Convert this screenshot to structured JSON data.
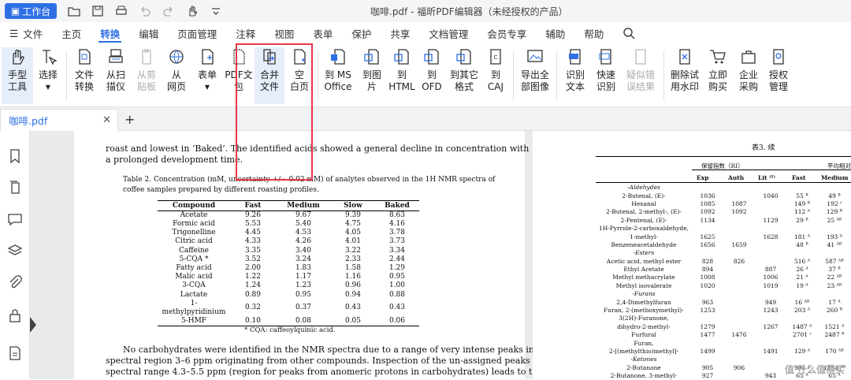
{
  "titlebar": {
    "work_label": "工作台",
    "title": "咖啡.pdf - 福昕PDF编辑器（未经授权的产品）"
  },
  "menu": [
    "文件",
    "主页",
    "转换",
    "编辑",
    "页面管理",
    "注释",
    "视图",
    "表单",
    "保护",
    "共享",
    "文档管理",
    "会员专享",
    "辅助",
    "帮助"
  ],
  "ribbon": {
    "hand": "手型\n工具",
    "select": "选择",
    "file_convert": "文件\n转换",
    "scan": "从扫\n描仪",
    "clipboard": "从剪\n贴板",
    "web": "从\n网页",
    "form": "表单",
    "pdf_pack": "PDF文\n包",
    "merge": "合并\n文件",
    "blank": "空\n白页",
    "to_ms": "到 MS\nOffice",
    "to_img": "到图\n片",
    "to_html": "到\nHTML",
    "to_ofd": "到\nOFD",
    "to_other": "到其它\n格式",
    "to_caj": "到\nCAJ",
    "export_img": "导出全\n部图像",
    "ocr": "识别\n文本",
    "quick_ocr": "快速\n识别",
    "suspect": "疑似错\n误结果",
    "remove_wm": "删除试\n用水印",
    "buy": "立即\n购买",
    "enterprise": "企业\n采购",
    "license": "授权\n管理"
  },
  "tabs": {
    "doc": "咖啡.pdf",
    "add": "+"
  },
  "page1": {
    "para1a": "roast and lowest in ‘Baked’. The identified acids showed a general decline in concentration with",
    "para1b": "a prolonged development time.",
    "caption_a": "Table 2. Concentration (mM, uncertainty +/− 0.02 mM) of analytes observed in the 1H NMR spectra of",
    "caption_b": "coffee samples prepared by different roasting profiles.",
    "headers": [
      "Compound",
      "Fast",
      "Medium",
      "Slow",
      "Baked"
    ],
    "rows": [
      [
        "Acetate",
        "9.26",
        "9.67",
        "9.39",
        "8.63"
      ],
      [
        "Formic acid",
        "5.53",
        "5.40",
        "4.75",
        "4.16"
      ],
      [
        "Trigonelline",
        "4.45",
        "4.53",
        "4.05",
        "3.78"
      ],
      [
        "Citric acid",
        "4.33",
        "4.26",
        "4.01",
        "3.73"
      ],
      [
        "Caffeine",
        "3.35",
        "3.40",
        "3.22",
        "3.34"
      ],
      [
        "5-CQA *",
        "3.52",
        "3.24",
        "2.33",
        "2.44"
      ],
      [
        "Fatty acid",
        "2.00",
        "1.83",
        "1.58",
        "1.29"
      ],
      [
        "Malic acid",
        "1.22",
        "1.17",
        "1.16",
        "0.95"
      ],
      [
        "3-CQA",
        "1.24",
        "1.23",
        "0.96",
        "1.00"
      ],
      [
        "Lactate",
        "0.89",
        "0.95",
        "0.94",
        "0.88"
      ],
      [
        "1-methylpyridinium",
        "0.32",
        "0.37",
        "0.43",
        "0.43"
      ],
      [
        "5-HMF",
        "0.10",
        "0.08",
        "0.05",
        "0.06"
      ]
    ],
    "footnote": "* CQA: caffeoylquinic acid.",
    "para2a": "No carbohydrates were identified in the NMR spectra due to a range of very intense peaks in the",
    "para2b": "spectral region 3–6 ppm originating from other compounds. Inspection of the un-assigned peaks in the",
    "para2c": "spectral range 4.3–5.5 ppm (region for peaks from anomeric protons in carbohydrates) leads to the"
  },
  "page2": {
    "title": "表3. 续",
    "head1": [
      "保留指数（RI）",
      "平均相对"
    ],
    "head2": [
      "Exp",
      "Auth",
      "Lit ⁽¹⁾",
      "Fast",
      "Medium"
    ],
    "rows": [
      {
        "g": "-Aldehydes"
      },
      {
        "n": "2-Butenal, (E)-",
        "e": "1036",
        "a": "",
        "l": "1040",
        "f": "55 ᴮ",
        "m": "49 ᴮ"
      },
      {
        "n": "Hexanal",
        "e": "1085",
        "a": "1087",
        "l": "",
        "f": "149 ᴮ",
        "m": "192 ᶜ"
      },
      {
        "n": "2-Butenal, 2-methyl-, (E)-",
        "e": "1092",
        "a": "1092",
        "l": "",
        "f": "112 ᴬ",
        "m": "129 ᴮ"
      },
      {
        "n": "2-Pentenal, (E)-",
        "e": "1134",
        "a": "",
        "l": "1129",
        "f": "29 ᴮ",
        "m": "25 ᴬᴮ"
      },
      {
        "n": "1H-Pyrrole-2-carboxaldehyde,",
        "e": "",
        "a": "",
        "l": "",
        "f": "",
        "m": ""
      },
      {
        "n": "1-methyl-",
        "e": "1625",
        "a": "",
        "l": "1628",
        "f": "181 ᴬ",
        "m": "193 ᴬ"
      },
      {
        "n": "Benzeneacetaldehyde",
        "e": "1656",
        "a": "1659",
        "l": "",
        "f": "48 ᴮ",
        "m": "41 ᴬᴮ"
      },
      {
        "g": "-Esters"
      },
      {
        "n": "Acetic acid, methyl ester",
        "e": "828",
        "a": "826",
        "l": "",
        "f": "516 ᴬ",
        "m": "587 ᴬᴮ"
      },
      {
        "n": "Ethyl Acetate",
        "e": "894",
        "a": "",
        "l": "887",
        "f": "26 ᴬ",
        "m": "37 ᴮ"
      },
      {
        "n": "Methyl methacrylate",
        "e": "1008",
        "a": "",
        "l": "1006",
        "f": "21 ᴬ",
        "m": "22 ᴬᴮ"
      },
      {
        "n": "Methyl isovalerate",
        "e": "1020",
        "a": "",
        "l": "1019",
        "f": "19 ᴬ",
        "m": "23 ᴬᴮ"
      },
      {
        "g": "-Furans"
      },
      {
        "n": "2,4-Dimethylfuran",
        "e": "963",
        "a": "",
        "l": "949",
        "f": "16 ᴬᴮ",
        "m": "17 ᴬ"
      },
      {
        "n": "Furan, 2-(methoxymethyl)-",
        "e": "1253",
        "a": "",
        "l": "1243",
        "f": "203 ᴬ",
        "m": "260 ᴮ"
      },
      {
        "n": "3(2H)-Furanone,",
        "e": "",
        "a": "",
        "l": "",
        "f": "",
        "m": ""
      },
      {
        "n": "dihydro-2-methyl-",
        "e": "1279",
        "a": "",
        "l": "1267",
        "f": "1487 ᴬ",
        "m": "1521 ᴬ"
      },
      {
        "n": "Furfural",
        "e": "1477",
        "a": "1476",
        "l": "",
        "f": "2701 ᶜ",
        "m": "2487 ᴮ"
      },
      {
        "n": "Furan,",
        "e": "",
        "a": "",
        "l": "",
        "f": "",
        "m": ""
      },
      {
        "n": "2-[(methylthio)methyl]-",
        "e": "1499",
        "a": "",
        "l": "1491",
        "f": "129 ᴬ",
        "m": "170 ᴬᴮ"
      },
      {
        "g": "-Ketones"
      },
      {
        "n": "2-Butanone",
        "e": "905",
        "a": "906",
        "l": "",
        "f": "995 ᴬ",
        "m": "1154 ᴬᴮ"
      },
      {
        "n": "2-Butanone, 3-methyl-",
        "e": "927",
        "a": "",
        "l": "943",
        "f": "65 ᴬ",
        "m": "65 ᴬ"
      }
    ],
    "watermark": "值 什么值得买"
  },
  "colors": {
    "accent": "#2f6fe4",
    "highlight": "#e8364a"
  }
}
